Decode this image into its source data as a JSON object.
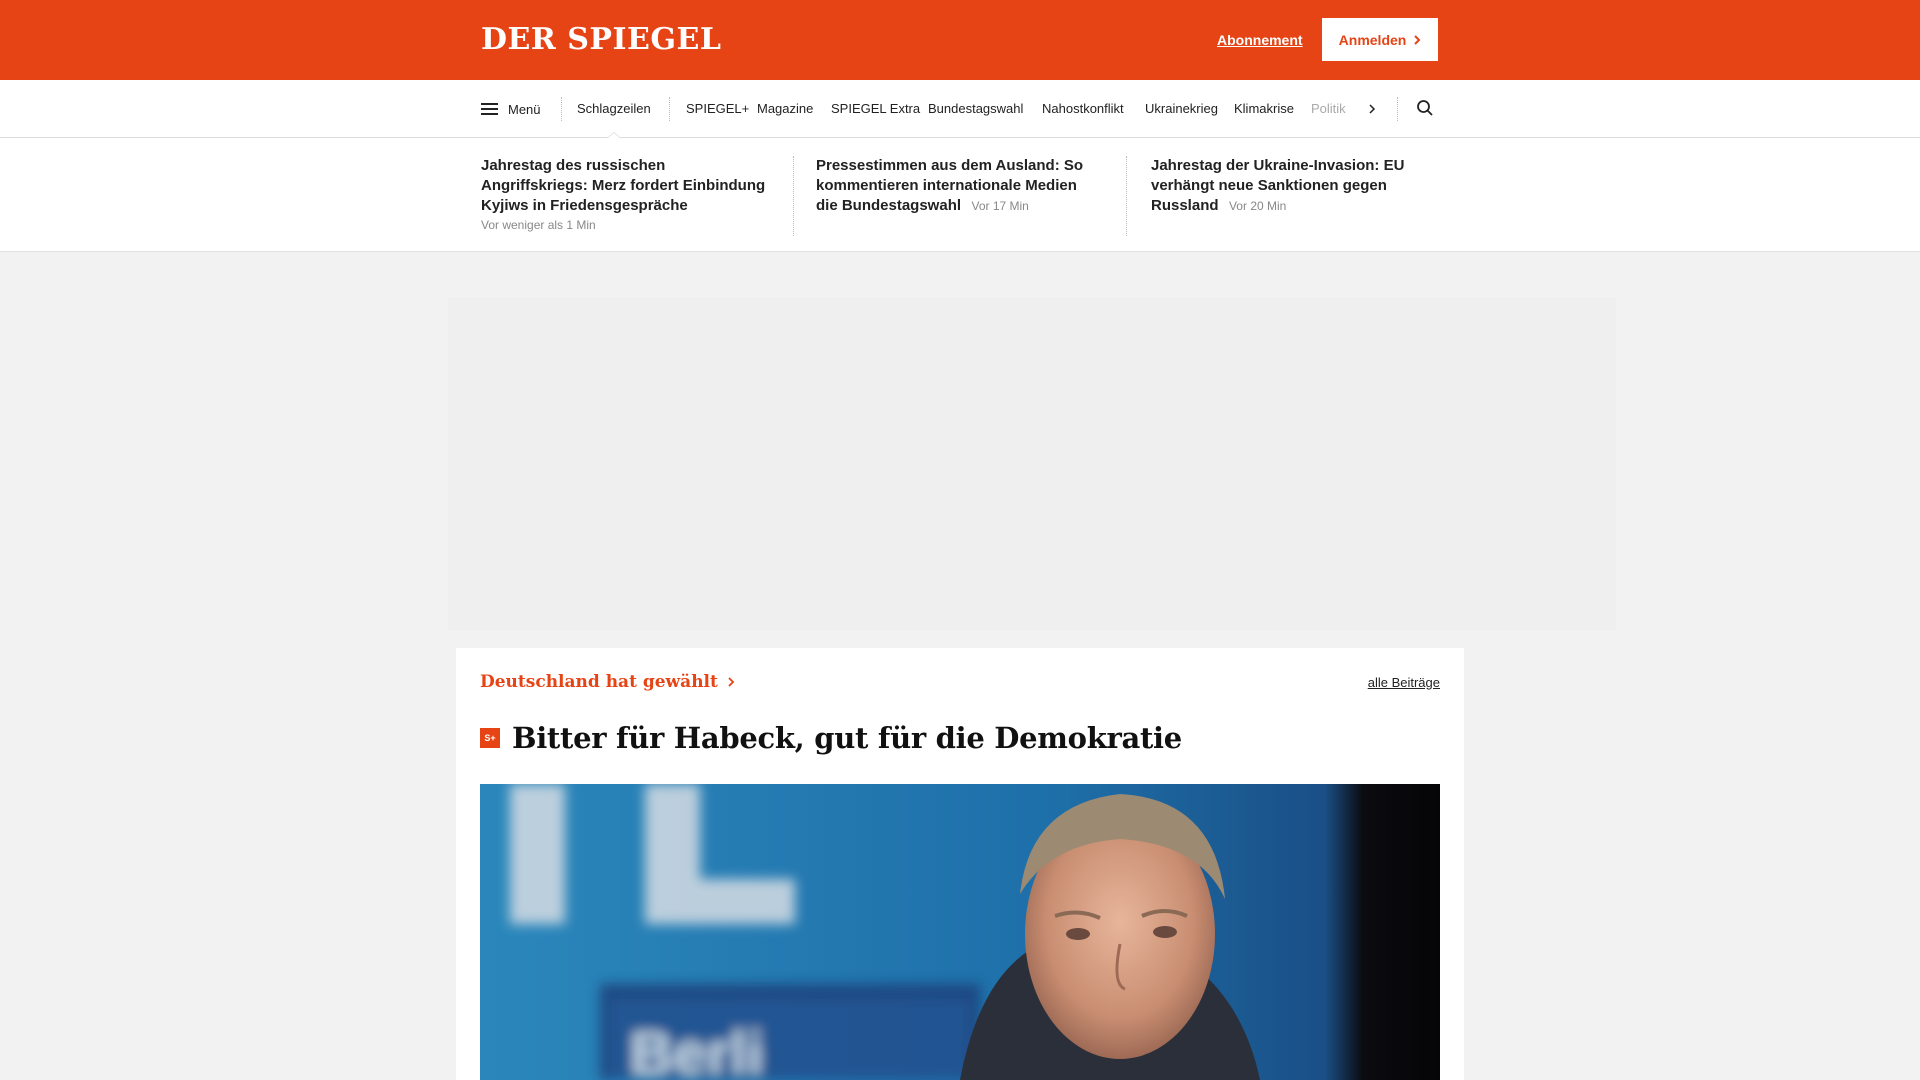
{
  "header": {
    "logo": "DER SPIEGEL",
    "abo_label": "Abonnement",
    "login_label": "Anmelden"
  },
  "nav": {
    "menu_label": "Menü",
    "items": [
      "Schlagzeilen",
      "SPIEGEL+",
      "Magazine",
      "SPIEGEL Extra",
      "Bundestagswahl",
      "Nahostkonflikt",
      "Ukrainekrieg",
      "Klimakrise",
      "Politik"
    ],
    "active": "Schlagzeilen"
  },
  "headlines": [
    {
      "title": "Jahrestag des russischen Angriffskriegs: Merz fordert Einbindung Kyjiws in Friedensgespräche",
      "time": "Vor weniger als 1 Min"
    },
    {
      "title": "Pressestimmen aus dem Ausland: So kommentieren internationale Medien die Bundestagswahl",
      "time": "Vor 17 Min"
    },
    {
      "title": "Jahrestag der Ukraine-Invasion: EU verhängt neue Sanktionen gegen Russland",
      "time": "Vor 20 Min"
    }
  ],
  "section": {
    "kicker": "Deutschland hat gewählt",
    "all_label": "alle Beiträge",
    "badge": "S+",
    "headline": "Bitter für Habeck, gut für die Demokratie"
  },
  "colors": {
    "brand": "#e64415",
    "background": "#f2f2f2"
  }
}
